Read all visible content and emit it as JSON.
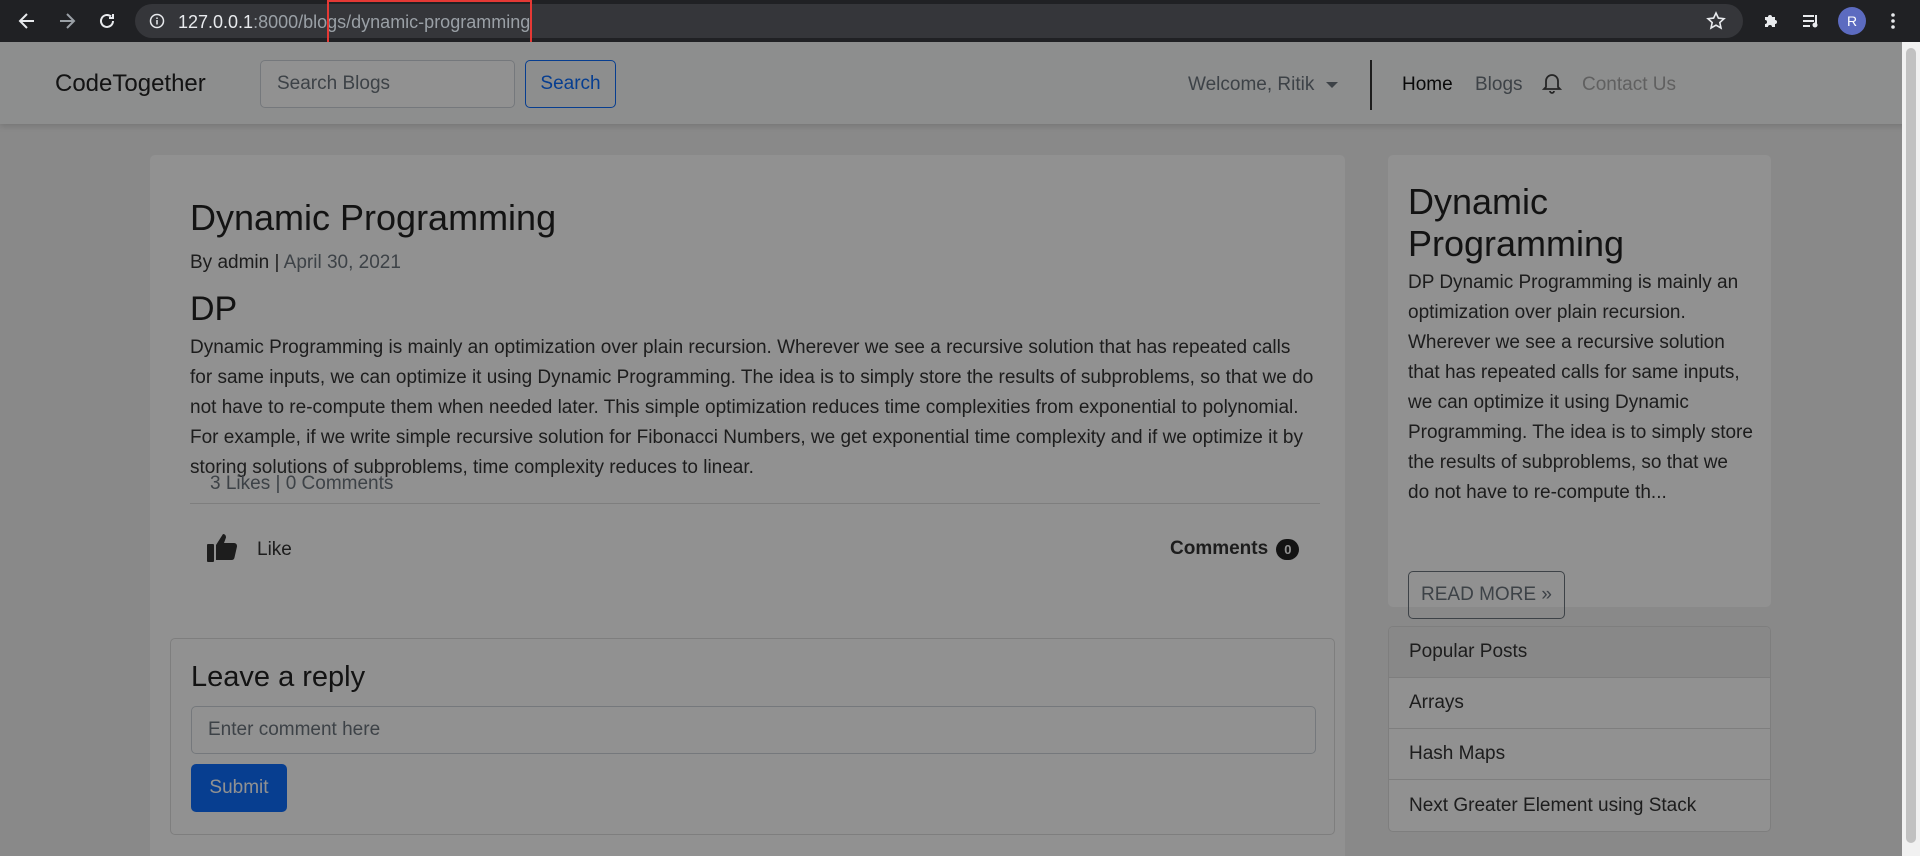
{
  "browser": {
    "url_host": "127.0.0.1",
    "url_port_path": ":8000/blogs",
    "url_slug": "/dynamic-programming",
    "avatar_letter": "R",
    "highlight_color": "#e53935"
  },
  "navbar": {
    "brand": "CodeTogether",
    "search_placeholder": "Search Blogs",
    "search_button": "Search",
    "welcome": "Welcome, Ritik",
    "links": {
      "home": "Home",
      "blogs": "Blogs",
      "contact": "Contact Us"
    },
    "accent_color": "#0d6efd"
  },
  "post": {
    "title": "Dynamic Programming",
    "by_label": "By",
    "author": "admin",
    "separator": "|",
    "date": "April 30, 2021",
    "subtitle": "DP",
    "body": "Dynamic Programming is mainly an optimization over plain recursion. Wherever we see a recursive solution that has repeated calls for same inputs, we can optimize it using Dynamic Programming. The idea is to simply store the results of subproblems, so that we do not have to re-compute them when needed later. This simple optimization reduces time complexities from exponential to polynomial. For example, if we write simple recursive solution for Fibonacci Numbers, we get exponential time complexity and if we optimize it by storing solutions of subproblems, time complexity reduces to linear.",
    "stats": "3 Likes | 0 Comments",
    "like_label": "Like",
    "comments_label": "Comments",
    "comments_count": "0"
  },
  "reply": {
    "title": "Leave a reply",
    "placeholder": "Enter comment here",
    "submit": "Submit"
  },
  "sidebar": {
    "title": "Dynamic Programming",
    "excerpt": "DP Dynamic Programming is mainly an optimization over plain recursion. Wherever we see a recursive solution that has repeated calls for same inputs, we can optimize it using Dynamic Programming. The idea is to simply store the results of subproblems, so that we do not have to re-compute th...",
    "read_more": "READ MORE »",
    "popular_header": "Popular Posts",
    "popular": [
      "Arrays",
      "Hash Maps",
      "Next Greater Element using Stack"
    ]
  },
  "icons": {
    "back": "back-arrow-icon",
    "forward": "forward-arrow-icon",
    "reload": "reload-icon",
    "info": "info-icon",
    "star": "star-icon",
    "extensions": "puzzle-icon",
    "media": "media-queue-icon",
    "menu": "kebab-menu-icon",
    "bell": "bell-icon",
    "like": "thumbs-up-icon"
  }
}
